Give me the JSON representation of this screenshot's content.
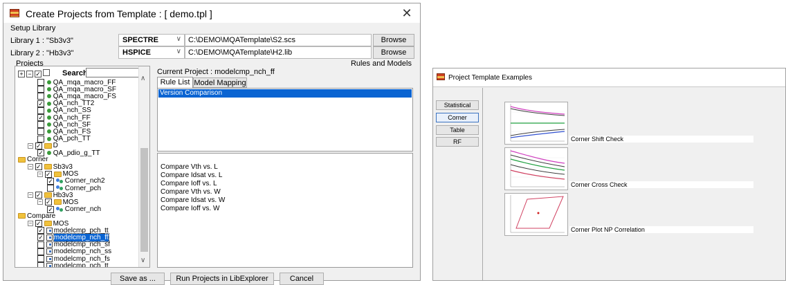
{
  "dialog": {
    "title": "Create Projects from Template : [ demo.tpl ]",
    "close_glyph": "✕",
    "setup_library_label": "Setup Library",
    "libraries": [
      {
        "label": "Library 1 : \"Sb3v3\"",
        "simulator": "SPECTRE",
        "path": "C:\\DEMO\\MQATemplate\\S2.scs",
        "browse": "Browse"
      },
      {
        "label": "Library 2 : \"Hb3v3\"",
        "simulator": "HSPICE",
        "path": "C:\\DEMO\\MQATemplate\\H2.lib",
        "browse": "Browse"
      }
    ],
    "projects_label": "Projects",
    "rules_models_label": "Rules and Models",
    "search_label": "Search:",
    "search_value": "",
    "current_project_label": "Current Project : modelcmp_nch_ff",
    "tabs": [
      "Rule List",
      "Model Mapping"
    ],
    "rule_list": [
      "Version Comparison"
    ],
    "comparisons": [
      "Compare Vth vs. L",
      "Compare Idsat vs. L",
      "Compare Ioff vs. L",
      "Compare Vth vs. W",
      "Compare Idsat vs. W",
      "Compare Ioff vs. W"
    ],
    "buttons": {
      "save_as": "Save as ...",
      "run": "Run Projects in LibExplorer",
      "cancel": "Cancel"
    },
    "tree": [
      {
        "depth": 2,
        "kind": "item",
        "label": "QA_mqa_macro_FF"
      },
      {
        "depth": 2,
        "kind": "item",
        "label": "QA_mqa_macro_SF"
      },
      {
        "depth": 2,
        "kind": "item",
        "label": "QA_mqa_macro_FS"
      },
      {
        "depth": 2,
        "kind": "item",
        "label": "QA_nch_TT2",
        "checked": true
      },
      {
        "depth": 2,
        "kind": "item",
        "label": "QA_nch_SS"
      },
      {
        "depth": 2,
        "kind": "item",
        "label": "QA_nch_FF",
        "checked": true
      },
      {
        "depth": 2,
        "kind": "item",
        "label": "QA_nch_SF"
      },
      {
        "depth": 2,
        "kind": "item",
        "label": "QA_nch_FS"
      },
      {
        "depth": 2,
        "kind": "item",
        "label": "QA_pch_TT"
      },
      {
        "depth": 1,
        "kind": "folder",
        "label": "D",
        "checked": true,
        "expand": "−"
      },
      {
        "depth": 2,
        "kind": "item",
        "label": "QA_pdio_g_TT",
        "checked": true
      },
      {
        "depth": 0,
        "kind": "folder",
        "label": "Corner"
      },
      {
        "depth": 1,
        "kind": "folder",
        "label": "Sb3v3",
        "checked": true,
        "expand": "−"
      },
      {
        "depth": 2,
        "kind": "folder",
        "label": "MOS",
        "checked": true,
        "expand": "−"
      },
      {
        "depth": 3,
        "kind": "clover",
        "label": "Corner_nch2",
        "checked": true
      },
      {
        "depth": 3,
        "kind": "clover",
        "label": "Corner_pch"
      },
      {
        "depth": 1,
        "kind": "folder",
        "label": "Hb3v3",
        "checked": true,
        "expand": "−"
      },
      {
        "depth": 2,
        "kind": "folder",
        "label": "MOS",
        "checked": true,
        "expand": "−"
      },
      {
        "depth": 3,
        "kind": "clover",
        "label": "Corner_nch",
        "checked": true
      },
      {
        "depth": 0,
        "kind": "folder",
        "label": "Compare"
      },
      {
        "depth": 1,
        "kind": "folder",
        "label": "MOS",
        "checked": true,
        "expand": "−"
      },
      {
        "depth": 2,
        "kind": "doc",
        "label": "modelcmp_pch_tt",
        "checked": true
      },
      {
        "depth": 2,
        "kind": "doc",
        "label": "modelcmp_nch_ff",
        "checked": true,
        "selected": true
      },
      {
        "depth": 2,
        "kind": "doc",
        "label": "modelcmp_nch_sf"
      },
      {
        "depth": 2,
        "kind": "doc",
        "label": "modelcmp_nch_ss"
      },
      {
        "depth": 2,
        "kind": "doc",
        "label": "modelcmp_nch_fs"
      },
      {
        "depth": 2,
        "kind": "doc",
        "label": "modelcmp_nch_tt"
      }
    ]
  },
  "template_window": {
    "title": "Project Template Examples",
    "categories": [
      {
        "label": "Statistical",
        "active": false
      },
      {
        "label": "Corner",
        "active": true
      },
      {
        "label": "Table",
        "active": false
      },
      {
        "label": "RF",
        "active": false
      }
    ],
    "examples": [
      {
        "caption": "Corner Shift Check"
      },
      {
        "caption": "Corner Cross Check"
      },
      {
        "caption": "Corner Plot NP Correlation"
      }
    ]
  },
  "colors": {
    "selection": "#0a64d2",
    "folder": "#f0c23c",
    "accent": "#3a72c0"
  }
}
